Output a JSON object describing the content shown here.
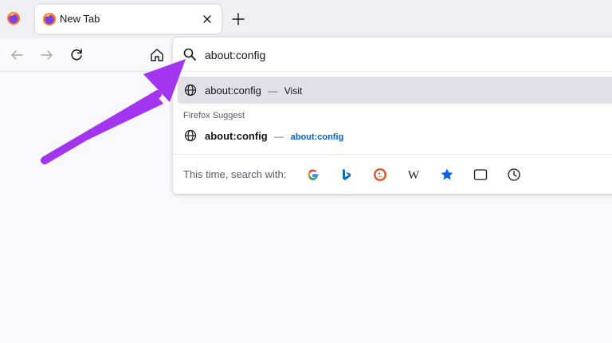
{
  "colors": {
    "accent_arrow": "#a335f0",
    "selected_row": "#e0e0e6",
    "link": "#0061e0",
    "tabstrip": "#f0f0f4",
    "content_bg": "#f9f9fb"
  },
  "tabstrip": {
    "tab_title": "New Tab",
    "icons": [
      "firefox-logo-icon",
      "close-icon",
      "plus-icon"
    ]
  },
  "navbar": {
    "icons": [
      "back-arrow-icon",
      "forward-arrow-icon",
      "reload-icon",
      "home-icon"
    ]
  },
  "urlbar": {
    "value": "about:config",
    "search_icon": "search-icon"
  },
  "results": {
    "top": {
      "title": "about:config",
      "dash": "—",
      "action": "Visit",
      "icon": "globe-icon"
    },
    "group_label": "Firefox Suggest",
    "suggest": {
      "title": "about:config",
      "dash": "—",
      "url": "about:config",
      "icon": "globe-icon"
    }
  },
  "search_footer": {
    "label": "This time, search with:",
    "engines": [
      {
        "name": "google-icon",
        "glyph": "G"
      },
      {
        "name": "bing-icon",
        "glyph": "b"
      },
      {
        "name": "duckduckgo-icon",
        "glyph": ""
      },
      {
        "name": "wikipedia-icon",
        "glyph": "W"
      },
      {
        "name": "bookmarks-star-icon",
        "glyph": ""
      },
      {
        "name": "tabs-icon",
        "glyph": ""
      },
      {
        "name": "history-clock-icon",
        "glyph": ""
      }
    ]
  }
}
